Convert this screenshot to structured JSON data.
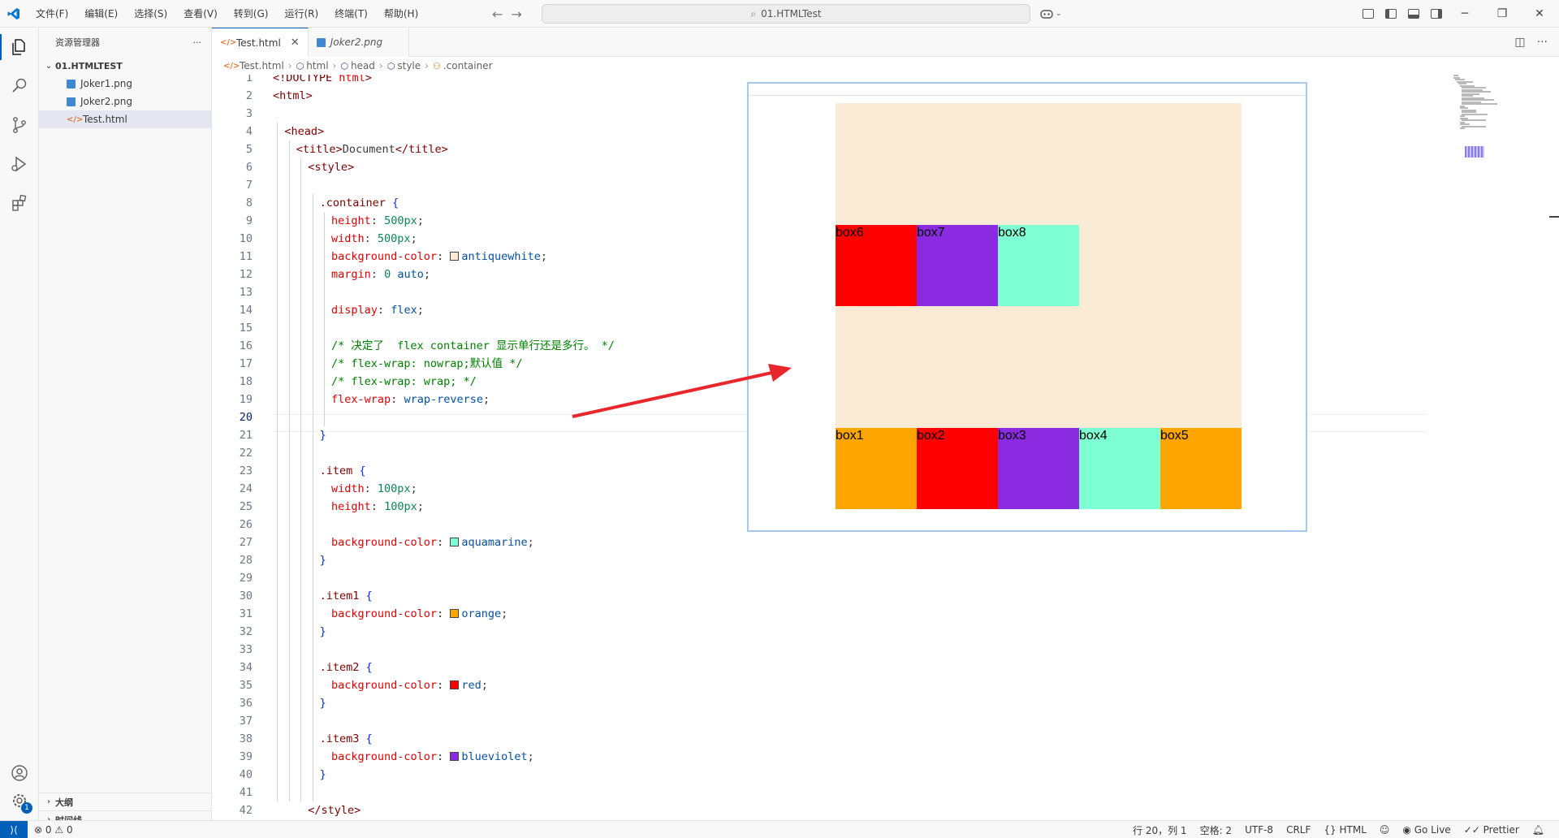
{
  "window": {
    "command_center": "01.HTMLTest",
    "menus": [
      "文件(F)",
      "编辑(E)",
      "选择(S)",
      "查看(V)",
      "转到(G)",
      "运行(R)",
      "终端(T)",
      "帮助(H)"
    ],
    "accent": "#005fb8"
  },
  "activity": {
    "icons": [
      "explorer-icon",
      "search-icon",
      "source-control-icon",
      "run-debug-icon",
      "extensions-icon",
      "account-icon",
      "settings-gear-icon"
    ],
    "settings_badge": "1"
  },
  "sidebar": {
    "title": "资源管理器",
    "more": "···",
    "folder": "01.HTMLTEST",
    "files": [
      {
        "name": "Joker1.png",
        "type": "image"
      },
      {
        "name": "Joker2.png",
        "type": "image"
      },
      {
        "name": "Test.html",
        "type": "html"
      }
    ],
    "outline": "大纲",
    "timeline": "时间线"
  },
  "tabs": [
    {
      "label": "Test.html",
      "active": true
    },
    {
      "label": "Joker2.png",
      "active": false
    }
  ],
  "breadcrumb": [
    "Test.html",
    "html",
    "head",
    "style",
    ".container"
  ],
  "editor": {
    "current_line": 20,
    "lines": [
      "<!DOCTYPE html>",
      "<html>",
      "",
      "<head>",
      "<title>Document</title>",
      "<style>",
      "",
      ".container {",
      "height: 500px;",
      "width: 500px;",
      "background-color: antiquewhite;",
      "margin: 0 auto;",
      "",
      "display: flex;",
      "",
      "/* 决定了  flex container 显示单行还是多行。 */",
      "/* flex-wrap: nowrap;默认值 */",
      "/* flex-wrap: wrap; */",
      "flex-wrap: wrap-reverse;",
      "",
      "}",
      "",
      ".item {",
      "width: 100px;",
      "height: 100px;",
      "",
      "background-color: aquamarine;",
      "}",
      "",
      ".item1 {",
      "background-color: orange;",
      "}",
      "",
      ".item2 {",
      "background-color: red;",
      "}",
      "",
      ".item3 {",
      "background-color: blueviolet;",
      "}",
      "",
      "</style>"
    ]
  },
  "preview": {
    "container_color": "#faebd7",
    "top_row": [
      {
        "label": "box6",
        "color": "#ff0000"
      },
      {
        "label": "box7",
        "color": "#8a2be2"
      },
      {
        "label": "box8",
        "color": "#7fffd4"
      }
    ],
    "bottom_row": [
      {
        "label": "box1",
        "color": "#ffa500"
      },
      {
        "label": "box2",
        "color": "#ff0000"
      },
      {
        "label": "box3",
        "color": "#8a2be2"
      },
      {
        "label": "box4",
        "color": "#7fffd4"
      },
      {
        "label": "box5",
        "color": "#ffa500"
      }
    ],
    "arrow_color": "#e8262b"
  },
  "statusbar": {
    "errors": "0",
    "warnings": "0",
    "position": "行 20，列 1",
    "spaces": "空格: 2",
    "encoding": "UTF-8",
    "eol": "CRLF",
    "language": "HTML",
    "golive": "Go Live",
    "prettier": "Prettier"
  }
}
